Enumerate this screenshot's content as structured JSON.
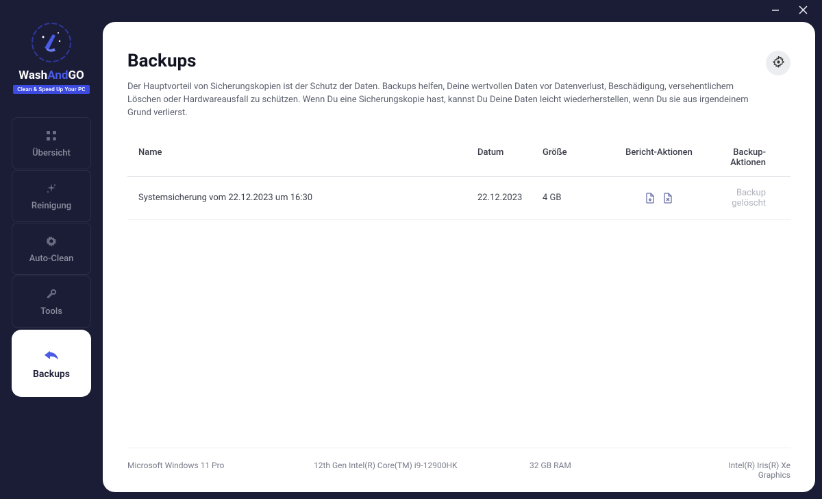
{
  "brand": {
    "part1": "Wash",
    "part2": "And",
    "part3": "GO",
    "tagline": "Clean & Speed Up Your PC"
  },
  "nav": {
    "overview": "Übersicht",
    "cleaning": "Reinigung",
    "autoclean": "Auto-Clean",
    "tools": "Tools",
    "backups": "Backups"
  },
  "page": {
    "title": "Backups",
    "description": "Der Hauptvorteil von Sicherungskopien ist der Schutz der Daten. Backups helfen, Deine wertvollen Daten vor Datenverlust, Beschädigung, versehentlichem Löschen oder Hardwareausfall zu schützen. Wenn Du eine Sicherungskopie hast, kannst Du Deine Daten leicht wiederherstellen, wenn Du sie aus irgendeinem Grund verlierst."
  },
  "table": {
    "headers": {
      "name": "Name",
      "date": "Datum",
      "size": "Größe",
      "report": "Bericht-Aktionen",
      "backup": "Backup-Aktionen"
    },
    "rows": [
      {
        "name": "Systemsicherung vom 22.12.2023 um 16:30",
        "date": "22.12.2023",
        "size": "4 GB",
        "backup_status": "Backup gelöscht"
      }
    ]
  },
  "footer": {
    "os": "Microsoft Windows 11 Pro",
    "cpu": "12th Gen Intel(R) Core(TM) i9-12900HK",
    "ram": "32 GB RAM",
    "gpu": "Intel(R) Iris(R) Xe Graphics"
  }
}
